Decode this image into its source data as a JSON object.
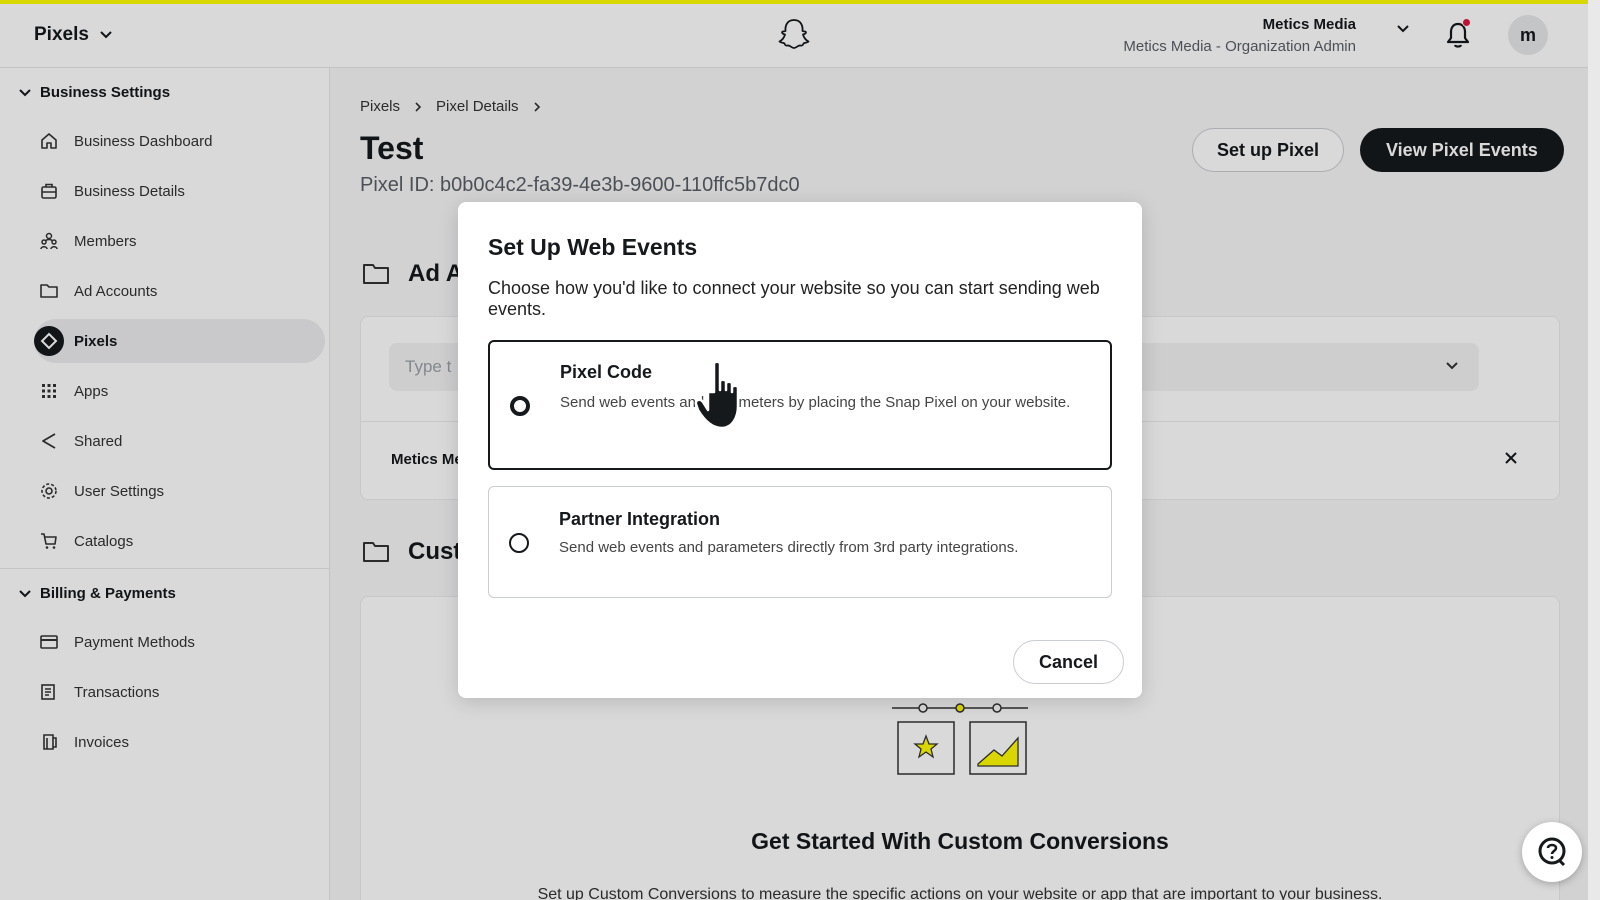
{
  "topbar": {
    "app_name": "Pixels",
    "org_name": "Metics Media",
    "org_role": "Metics Media - Organization Admin",
    "avatar_letter": "m",
    "accent_color": "#fffc00",
    "notification_dot_color": "#e1143d"
  },
  "sidebar": {
    "business_settings_label": "Business Settings",
    "business_items": [
      {
        "label": "Business Dashboard",
        "icon": "home-icon"
      },
      {
        "label": "Business Details",
        "icon": "briefcase-icon"
      },
      {
        "label": "Members",
        "icon": "members-icon"
      },
      {
        "label": "Ad Accounts",
        "icon": "folder-icon"
      },
      {
        "label": "Pixels",
        "icon": "pixel-icon",
        "active": true
      },
      {
        "label": "Apps",
        "icon": "grid-icon"
      },
      {
        "label": "Shared",
        "icon": "share-icon"
      },
      {
        "label": "User Settings",
        "icon": "gear-icon"
      },
      {
        "label": "Catalogs",
        "icon": "cart-icon"
      }
    ],
    "billing_label": "Billing & Payments",
    "billing_items": [
      {
        "label": "Payment Methods",
        "icon": "card-icon"
      },
      {
        "label": "Transactions",
        "icon": "receipt-icon"
      },
      {
        "label": "Invoices",
        "icon": "invoice-icon"
      }
    ]
  },
  "main": {
    "breadcrumb": [
      "Pixels",
      "Pixel Details"
    ],
    "title": "Test",
    "pixel_id": "Pixel ID: b0b0c4c2-fa39-4e3b-9600-110ffc5b7dc0",
    "setup_button": "Set up Pixel",
    "view_events_button": "View Pixel Events",
    "ad_accounts_title": "Ad A",
    "search_placeholder": "Type t",
    "row_account": "Metics Me",
    "custom_title": "Cust",
    "cta_title": "Get Started With Custom Conversions",
    "cta_text": "Set up Custom Conversions to measure the specific actions on your website or app that are important to your business."
  },
  "modal": {
    "title": "Set Up Web Events",
    "description": "Choose how you'd like to connect your website so you can start sending web events.",
    "options": [
      {
        "title": "Pixel Code",
        "description": "Send web events and parameters by placing the Snap Pixel on your website.",
        "selected": true
      },
      {
        "title": "Partner Integration",
        "description": "Send web events and parameters directly from 3rd party integrations.",
        "selected": false
      }
    ],
    "cancel": "Cancel"
  }
}
